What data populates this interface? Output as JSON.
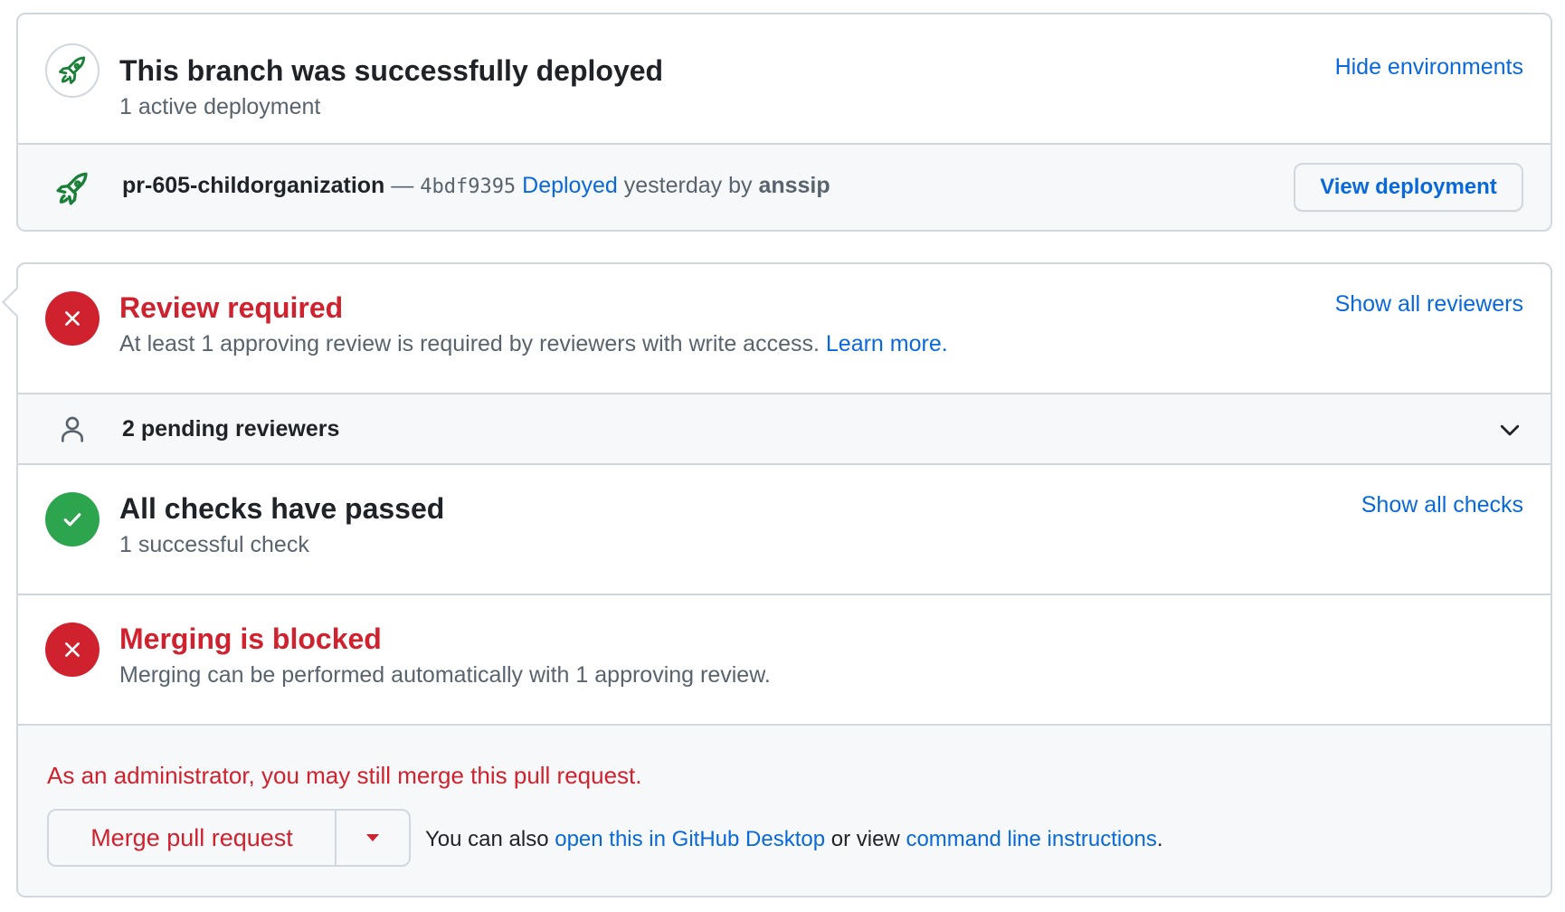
{
  "deployment": {
    "title": "This branch was successfully deployed",
    "subtitle": "1 active deployment",
    "hide_link": "Hide environments",
    "environment": "pr-605-childorganization",
    "dash": "—",
    "sha": "4bdf9395",
    "deployed_link": "Deployed",
    "time_text": "yesterday by",
    "deployer": "anssip",
    "view_button": "View deployment"
  },
  "review": {
    "title": "Review required",
    "description": "At least 1 approving review is required by reviewers with write access.",
    "learn_more": "Learn more.",
    "show_link": "Show all reviewers"
  },
  "pending": {
    "label": "2 pending reviewers"
  },
  "checks": {
    "title": "All checks have passed",
    "subtitle": "1 successful check",
    "show_link": "Show all checks"
  },
  "blocked": {
    "title": "Merging is blocked",
    "subtitle": "Merging can be performed automatically with 1 approving review."
  },
  "admin": {
    "notice": "As an administrator, you may still merge this pull request.",
    "merge_button": "Merge pull request",
    "also_prefix": "You can also",
    "desktop_link": "open this in GitHub Desktop",
    "or_view": "or view",
    "cli_link": "command line instructions",
    "period": "."
  },
  "colors": {
    "accent_blue": "#0969da",
    "danger_red": "#cf222e",
    "success_green": "#2da44e",
    "rocket_green": "#1a7f37",
    "border": "#d0d7de",
    "muted_bg": "#f6f8fa"
  },
  "icons": {
    "deployment_status": "rocket-icon",
    "environment_row": "rocket-icon",
    "review_status": "x-circle-icon",
    "pending": "person-icon",
    "expand": "chevron-down-icon",
    "checks_status": "check-circle-icon",
    "blocked_status": "x-circle-icon",
    "merge_dropdown": "triangle-down-icon"
  }
}
